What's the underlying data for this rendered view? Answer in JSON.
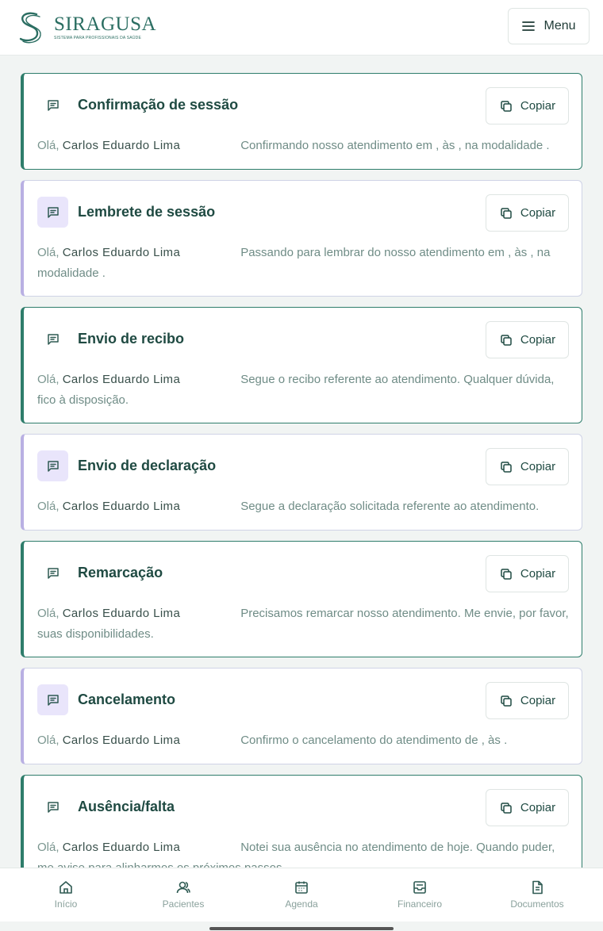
{
  "app": {
    "logo_word": "SIRAGUSA",
    "logo_tagline": "SISTEMA PARA PROFISSIONAIS DA SAÚDE",
    "menu_label": "Menu"
  },
  "templates": [
    {
      "title": "Confirmação de sessão",
      "greeting": "Olá,",
      "name": "Carlos Eduardo Lima",
      "message": "Confirmando nosso atendimento em , às , na modalidade .",
      "copy_label": "Copiar",
      "variant": "green"
    },
    {
      "title": "Lembrete de sessão",
      "greeting": "Olá,",
      "name": "Carlos Eduardo Lima",
      "message": "Passando para lembrar do nosso atendimento em , às , na modalidade .",
      "copy_label": "Copiar",
      "variant": "purple"
    },
    {
      "title": "Envio de recibo",
      "greeting": "Olá,",
      "name": "Carlos Eduardo Lima",
      "message": "Segue o recibo referente ao atendimento. Qualquer dúvida, fico à disposição.",
      "copy_label": "Copiar",
      "variant": "green"
    },
    {
      "title": "Envio de declaração",
      "greeting": "Olá,",
      "name": "Carlos Eduardo Lima",
      "message": "Segue a declaração solicitada referente ao atendimento.",
      "copy_label": "Copiar",
      "variant": "purple"
    },
    {
      "title": "Remarcação",
      "greeting": "Olá,",
      "name": "Carlos Eduardo Lima",
      "message": "Precisamos remarcar nosso atendimento. Me envie, por favor, suas disponibilidades.",
      "copy_label": "Copiar",
      "variant": "green"
    },
    {
      "title": "Cancelamento",
      "greeting": "Olá,",
      "name": "Carlos Eduardo Lima",
      "message": "Confirmo o cancelamento do atendimento de , às .",
      "copy_label": "Copiar",
      "variant": "purple"
    },
    {
      "title": "Ausência/falta",
      "greeting": "Olá,",
      "name": "Carlos Eduardo Lima",
      "message": "Notei sua ausência no atendimento de hoje. Quando puder, me avise para alinharmos os próximos passos.",
      "copy_label": "Copiar",
      "variant": "green"
    }
  ],
  "nav": [
    {
      "label": "Início",
      "icon": "home-icon"
    },
    {
      "label": "Pacientes",
      "icon": "users-icon"
    },
    {
      "label": "Agenda",
      "icon": "calendar-icon"
    },
    {
      "label": "Financeiro",
      "icon": "inbox-icon"
    },
    {
      "label": "Documentos",
      "icon": "document-icon"
    }
  ],
  "colors": {
    "accent": "#2e7d6b",
    "secondary_accent": "#b9b0e3",
    "secondary_icon_bg": "#e9e5fb"
  }
}
